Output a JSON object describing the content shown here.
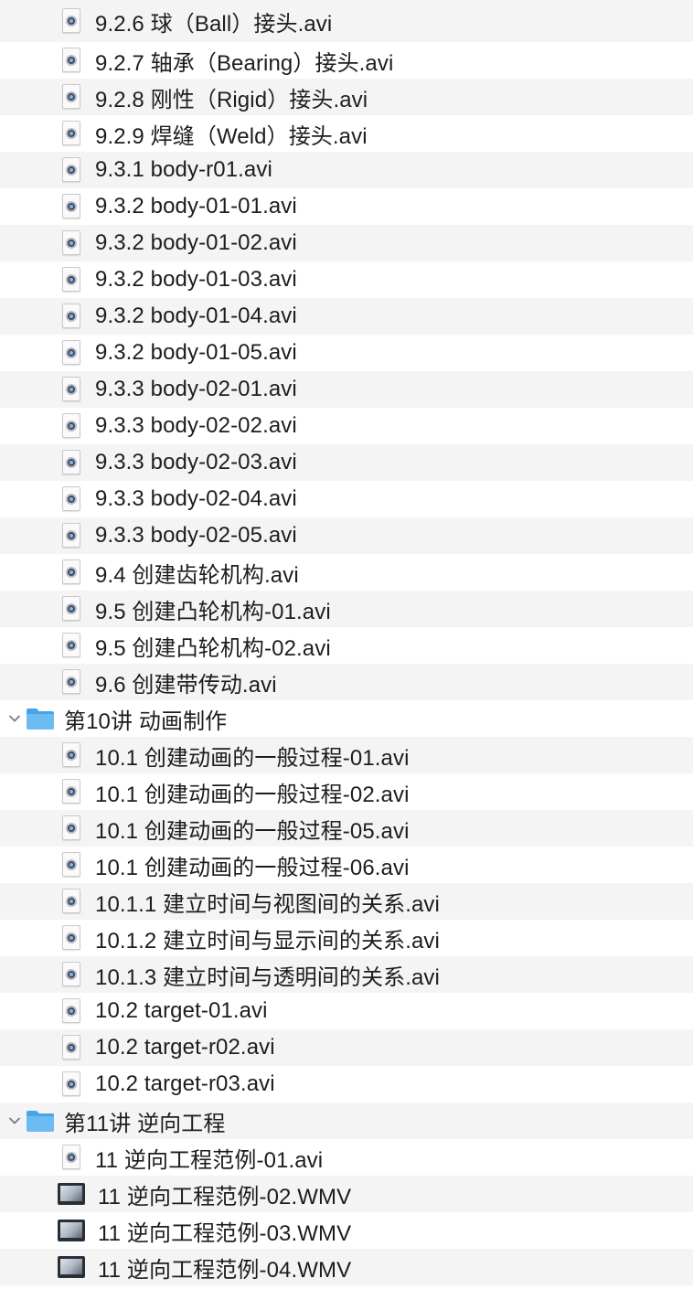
{
  "rows": [
    {
      "type": "file",
      "icon": "video-file-icon",
      "label": "9.2.6  球（Ball）接头.avi"
    },
    {
      "type": "file",
      "icon": "video-file-icon",
      "label": "9.2.7  轴承（Bearing）接头.avi"
    },
    {
      "type": "file",
      "icon": "video-file-icon",
      "label": "9.2.8  刚性（Rigid）接头.avi"
    },
    {
      "type": "file",
      "icon": "video-file-icon",
      "label": "9.2.9  焊缝（Weld）接头.avi"
    },
    {
      "type": "file",
      "icon": "video-file-icon",
      "label": "9.3.1 body-r01.avi"
    },
    {
      "type": "file",
      "icon": "video-file-icon",
      "label": "9.3.2 body-01-01.avi"
    },
    {
      "type": "file",
      "icon": "video-file-icon",
      "label": "9.3.2 body-01-02.avi"
    },
    {
      "type": "file",
      "icon": "video-file-icon",
      "label": "9.3.2 body-01-03.avi"
    },
    {
      "type": "file",
      "icon": "video-file-icon",
      "label": "9.3.2 body-01-04.avi"
    },
    {
      "type": "file",
      "icon": "video-file-icon",
      "label": "9.3.2 body-01-05.avi"
    },
    {
      "type": "file",
      "icon": "video-file-icon",
      "label": "9.3.3 body-02-01.avi"
    },
    {
      "type": "file",
      "icon": "video-file-icon",
      "label": "9.3.3 body-02-02.avi"
    },
    {
      "type": "file",
      "icon": "video-file-icon",
      "label": "9.3.3 body-02-03.avi"
    },
    {
      "type": "file",
      "icon": "video-file-icon",
      "label": "9.3.3 body-02-04.avi"
    },
    {
      "type": "file",
      "icon": "video-file-icon",
      "label": "9.3.3 body-02-05.avi"
    },
    {
      "type": "file",
      "icon": "video-file-icon",
      "label": "9.4  创建齿轮机构.avi"
    },
    {
      "type": "file",
      "icon": "video-file-icon",
      "label": "9.5  创建凸轮机构-01.avi"
    },
    {
      "type": "file",
      "icon": "video-file-icon",
      "label": "9.5  创建凸轮机构-02.avi"
    },
    {
      "type": "file",
      "icon": "video-file-icon",
      "label": "9.6  创建带传动.avi"
    },
    {
      "type": "folder",
      "icon": "folder-icon",
      "label": "第10讲 动画制作"
    },
    {
      "type": "file",
      "icon": "video-file-icon",
      "label": "10.1  创建动画的一般过程-01.avi"
    },
    {
      "type": "file",
      "icon": "video-file-icon",
      "label": "10.1  创建动画的一般过程-02.avi"
    },
    {
      "type": "file",
      "icon": "video-file-icon",
      "label": "10.1  创建动画的一般过程-05.avi"
    },
    {
      "type": "file",
      "icon": "video-file-icon",
      "label": "10.1  创建动画的一般过程-06.avi"
    },
    {
      "type": "file",
      "icon": "video-file-icon",
      "label": "10.1.1  建立时间与视图间的关系.avi"
    },
    {
      "type": "file",
      "icon": "video-file-icon",
      "label": "10.1.2  建立时间与显示间的关系.avi"
    },
    {
      "type": "file",
      "icon": "video-file-icon",
      "label": "10.1.3  建立时间与透明间的关系.avi"
    },
    {
      "type": "file",
      "icon": "video-file-icon",
      "label": "10.2 target-01.avi"
    },
    {
      "type": "file",
      "icon": "video-file-icon",
      "label": "10.2 target-r02.avi"
    },
    {
      "type": "file",
      "icon": "video-file-icon",
      "label": "10.2 target-r03.avi"
    },
    {
      "type": "folder",
      "icon": "folder-icon",
      "label": "第11讲 逆向工程"
    },
    {
      "type": "file",
      "icon": "video-file-icon",
      "label": "11  逆向工程范例-01.avi"
    },
    {
      "type": "file",
      "icon": "wmv-file-icon",
      "label": "11  逆向工程范例-02.WMV"
    },
    {
      "type": "file",
      "icon": "wmv-file-icon",
      "label": "11  逆向工程范例-03.WMV"
    },
    {
      "type": "file",
      "icon": "wmv-file-icon",
      "label": "11  逆向工程范例-04.WMV"
    }
  ],
  "colors": {
    "stripe": "#f4f4f5",
    "folder": "#5fb3ee",
    "text": "#1d1d1f"
  }
}
